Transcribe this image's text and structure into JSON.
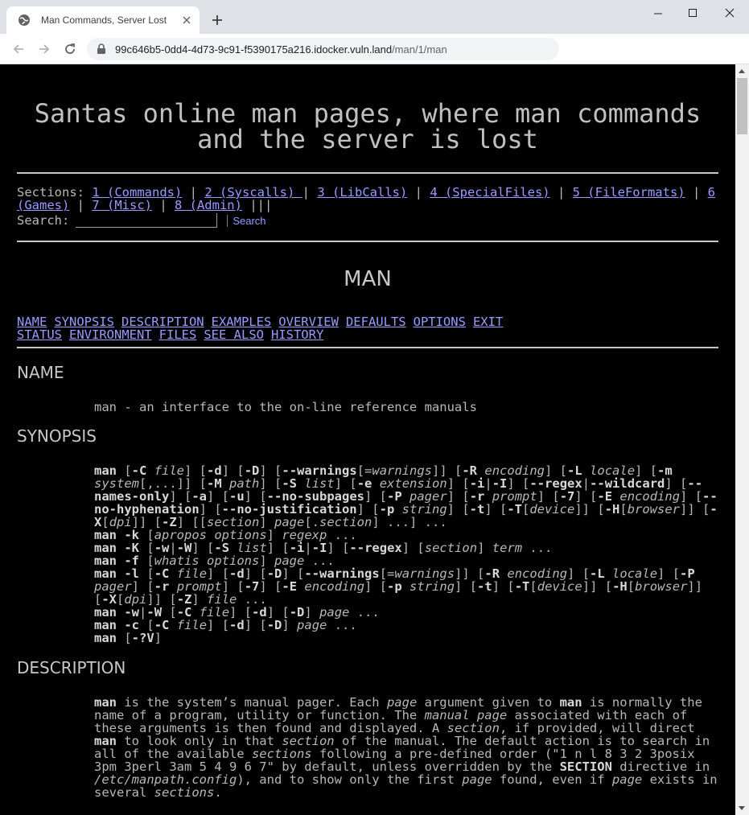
{
  "browser": {
    "tab_title": "Man Commands, Server Lost",
    "url_host": "99c646b5-0dd4-4d73-9c91-f5390175a216.idocker.vuln.land",
    "url_path": "/man/1/man"
  },
  "site": {
    "title": "Santas online man pages, where man commands and the server is lost",
    "sections_label": "Sections:",
    "sections": [
      "1 (Commands)",
      "2 (Syscalls) ",
      "3 (LibCalls)",
      "4 (SpecialFiles)",
      "5 (FileFormats)",
      "6 (Games)",
      "7 (Misc)",
      "8 (Admin)"
    ],
    "sections_trailer": "|||",
    "search_label": "Search:",
    "search_value": "",
    "search_button": "Search"
  },
  "man": {
    "title": "MAN",
    "toc": [
      "NAME",
      "SYNOPSIS",
      "DESCRIPTION",
      "EXAMPLES",
      "OVERVIEW",
      "DEFAULTS",
      "OPTIONS",
      "EXIT STATUS",
      "ENVIRONMENT",
      "FILES",
      "SEE ALSO",
      "HISTORY"
    ],
    "name_heading": "NAME",
    "name_text": "man - an interface to the on-line reference manuals",
    "synopsis_heading": "SYNOPSIS",
    "description_heading": "DESCRIPTION"
  }
}
